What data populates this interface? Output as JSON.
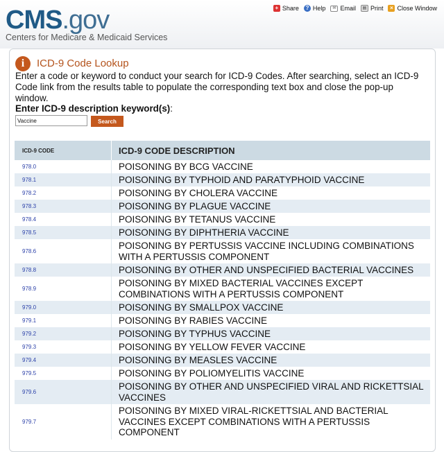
{
  "header": {
    "logo_cms": "CMS",
    "logo_gov": ".gov",
    "subtitle": "Centers for Medicare & Medicaid Services",
    "tools": [
      {
        "label": "Share",
        "icon": "share-icon"
      },
      {
        "label": "Help",
        "icon": "help-icon"
      },
      {
        "label": "Email",
        "icon": "email-icon"
      },
      {
        "label": "Print",
        "icon": "print-icon"
      },
      {
        "label": "Close Window",
        "icon": "close-window-icon"
      }
    ]
  },
  "lookup": {
    "title": "ICD-9 Code Lookup",
    "instructions": "Enter a code or keyword to conduct your search for ICD-9 Codes. After searching, select an ICD-9 Code link from the results table to populate the corresponding text box and close the pop-up window.",
    "keyword_label": "Enter ICD-9 description keyword(s)",
    "keyword_colon": ":",
    "keyword_value": "Vaccine",
    "search_label": "Search"
  },
  "results": {
    "col_code": "ICD-9 CODE",
    "col_desc": "ICD-9 CODE DESCRIPTION",
    "rows": [
      {
        "code": "978.0",
        "desc": "POISONING BY BCG VACCINE"
      },
      {
        "code": "978.1",
        "desc": "POISONING BY TYPHOID AND PARATYPHOID VACCINE"
      },
      {
        "code": "978.2",
        "desc": "POISONING BY CHOLERA VACCINE"
      },
      {
        "code": "978.3",
        "desc": "POISONING BY PLAGUE VACCINE"
      },
      {
        "code": "978.4",
        "desc": "POISONING BY TETANUS VACCINE"
      },
      {
        "code": "978.5",
        "desc": "POISONING BY DIPHTHERIA VACCINE"
      },
      {
        "code": "978.6",
        "desc": "POISONING BY PERTUSSIS VACCINE INCLUDING COMBINATIONS WITH A PERTUSSIS COMPONENT"
      },
      {
        "code": "978.8",
        "desc": "POISONING BY OTHER AND UNSPECIFIED BACTERIAL VACCINES"
      },
      {
        "code": "978.9",
        "desc": "POISONING BY MIXED BACTERIAL VACCINES EXCEPT COMBINATIONS WITH A PERTUSSIS COMPONENT"
      },
      {
        "code": "979.0",
        "desc": "POISONING BY SMALLPOX VACCINE"
      },
      {
        "code": "979.1",
        "desc": "POISONING BY RABIES VACCINE"
      },
      {
        "code": "979.2",
        "desc": "POISONING BY TYPHUS VACCINE"
      },
      {
        "code": "979.3",
        "desc": "POISONING BY YELLOW FEVER VACCINE"
      },
      {
        "code": "979.4",
        "desc": "POISONING BY MEASLES VACCINE"
      },
      {
        "code": "979.5",
        "desc": "POISONING BY POLIOMYELITIS VACCINE"
      },
      {
        "code": "979.6",
        "desc": "POISONING BY OTHER AND UNSPECIFIED VIRAL AND RICKETTSIAL VACCINES"
      },
      {
        "code": "979.7",
        "desc": "POISONING BY MIXED VIRAL-RICKETTSIAL AND BACTERIAL VACCINES EXCEPT COMBINATIONS WITH A PERTUSSIS COMPONENT"
      }
    ]
  }
}
